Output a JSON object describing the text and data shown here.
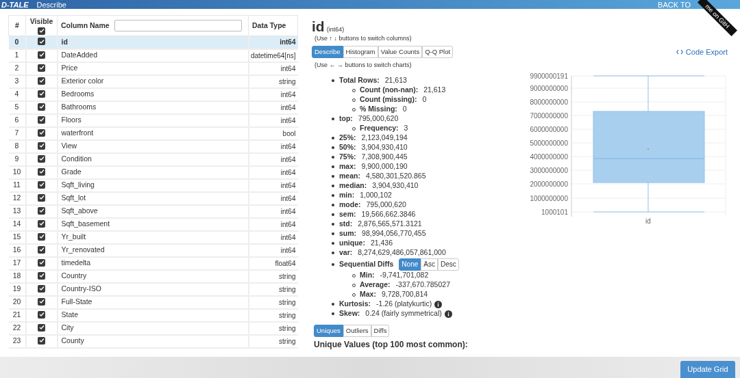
{
  "header": {
    "logo": "D-TALE",
    "title": "Describe",
    "back_label": "BACK TO",
    "ribbon": "me on GitH"
  },
  "columns_table": {
    "headers": {
      "index": "#",
      "visible": "Visible",
      "name": "Column Name",
      "dtype": "Data Type"
    },
    "all_visible": true,
    "rows": [
      {
        "index": "0",
        "name": "id",
        "dtype": "int64",
        "visible": true,
        "selected": true
      },
      {
        "index": "1",
        "name": "DateAdded",
        "dtype": "datetime64[ns]",
        "visible": true,
        "selected": false
      },
      {
        "index": "2",
        "name": "Price",
        "dtype": "int64",
        "visible": true,
        "selected": false
      },
      {
        "index": "3",
        "name": "Exterior color",
        "dtype": "string",
        "visible": true,
        "selected": false
      },
      {
        "index": "4",
        "name": "Bedrooms",
        "dtype": "int64",
        "visible": true,
        "selected": false
      },
      {
        "index": "5",
        "name": "Bathrooms",
        "dtype": "int64",
        "visible": true,
        "selected": false
      },
      {
        "index": "6",
        "name": "Floors",
        "dtype": "int64",
        "visible": true,
        "selected": false
      },
      {
        "index": "7",
        "name": "waterfront",
        "dtype": "bool",
        "visible": true,
        "selected": false
      },
      {
        "index": "8",
        "name": "View",
        "dtype": "int64",
        "visible": true,
        "selected": false
      },
      {
        "index": "9",
        "name": "Condition",
        "dtype": "int64",
        "visible": true,
        "selected": false
      },
      {
        "index": "10",
        "name": "Grade",
        "dtype": "int64",
        "visible": true,
        "selected": false
      },
      {
        "index": "11",
        "name": "Sqft_living",
        "dtype": "int64",
        "visible": true,
        "selected": false
      },
      {
        "index": "12",
        "name": "Sqft_lot",
        "dtype": "int64",
        "visible": true,
        "selected": false
      },
      {
        "index": "13",
        "name": "Sqft_above",
        "dtype": "int64",
        "visible": true,
        "selected": false
      },
      {
        "index": "14",
        "name": "Sqft_basement",
        "dtype": "int64",
        "visible": true,
        "selected": false
      },
      {
        "index": "15",
        "name": "Yr_built",
        "dtype": "int64",
        "visible": true,
        "selected": false
      },
      {
        "index": "16",
        "name": "Yr_renovated",
        "dtype": "int64",
        "visible": true,
        "selected": false
      },
      {
        "index": "17",
        "name": "timedelta",
        "dtype": "float64",
        "visible": true,
        "selected": false
      },
      {
        "index": "18",
        "name": "Country",
        "dtype": "string",
        "visible": true,
        "selected": false
      },
      {
        "index": "19",
        "name": "Country-ISO",
        "dtype": "string",
        "visible": true,
        "selected": false
      },
      {
        "index": "20",
        "name": "Full-State",
        "dtype": "string",
        "visible": true,
        "selected": false
      },
      {
        "index": "21",
        "name": "State",
        "dtype": "string",
        "visible": true,
        "selected": false
      },
      {
        "index": "22",
        "name": "City",
        "dtype": "string",
        "visible": true,
        "selected": false
      },
      {
        "index": "23",
        "name": "County",
        "dtype": "string",
        "visible": true,
        "selected": false
      }
    ]
  },
  "details": {
    "column": "id",
    "dtype": "(int64)",
    "hint_columns": "(Use ↑ ↓ buttons to switch columns)",
    "chart_tabs": [
      {
        "label": "Describe",
        "selected": true
      },
      {
        "label": "Histogram",
        "selected": false
      },
      {
        "label": "Value Counts",
        "selected": false
      },
      {
        "label": "Q-Q Plot",
        "selected": false
      }
    ],
    "hint_charts": "(Use ← → buttons to switch charts)",
    "code_export": "Code Export",
    "stats": [
      {
        "kind": "stat",
        "label": "Total Rows:",
        "value": "21,613",
        "children": [
          {
            "label": "Count (non-nan):",
            "value": "21,613"
          },
          {
            "label": "Count (missing):",
            "value": "0"
          },
          {
            "label": "% Missing:",
            "value": "0"
          }
        ]
      },
      {
        "kind": "stat",
        "label": "top:",
        "value": "795,000,620",
        "children": [
          {
            "label": "Frequency:",
            "value": "3"
          }
        ]
      },
      {
        "kind": "stat",
        "label": "25%:",
        "value": "2,123,049,194"
      },
      {
        "kind": "stat",
        "label": "50%:",
        "value": "3,904,930,410"
      },
      {
        "kind": "stat",
        "label": "75%:",
        "value": "7,308,900,445"
      },
      {
        "kind": "stat",
        "label": "max:",
        "value": "9,900,000,190"
      },
      {
        "kind": "stat",
        "label": "mean:",
        "value": "4,580,301,520.865"
      },
      {
        "kind": "stat",
        "label": "median:",
        "value": "3,904,930,410"
      },
      {
        "kind": "stat",
        "label": "min:",
        "value": "1,000,102"
      },
      {
        "kind": "stat",
        "label": "mode:",
        "value": "795,000,620"
      },
      {
        "kind": "stat",
        "label": "sem:",
        "value": "19,566,662.3846"
      },
      {
        "kind": "stat",
        "label": "std:",
        "value": "2,876,565,571.3121"
      },
      {
        "kind": "stat",
        "label": "sum:",
        "value": "98,994,056,770,455"
      },
      {
        "kind": "stat",
        "label": "unique:",
        "value": "21,436"
      },
      {
        "kind": "stat",
        "label": "var:",
        "value": "8,274,629,486,057,861,000"
      },
      {
        "kind": "toggle",
        "label": "Sequential Diffs",
        "options": [
          {
            "label": "None",
            "selected": true
          },
          {
            "label": "Asc",
            "selected": false
          },
          {
            "label": "Desc",
            "selected": false
          }
        ],
        "children": [
          {
            "label": "Min:",
            "value": "-9,741,701,082"
          },
          {
            "label": "Average:",
            "value": "-337,670.785027"
          },
          {
            "label": "Max:",
            "value": "9,728,700,814"
          }
        ]
      },
      {
        "kind": "info",
        "label": "Kurtosis:",
        "value": "-1.26 (platykurtic)"
      },
      {
        "kind": "info",
        "label": "Skew:",
        "value": "0.24 (fairly symmetrical)"
      }
    ],
    "bottom_tabs": [
      {
        "label": "Uniques",
        "selected": true
      },
      {
        "label": "Outliers",
        "selected": false
      },
      {
        "label": "Diffs",
        "selected": false
      }
    ],
    "uniques_heading": "Unique Values (top 100 most common):"
  },
  "chart": {
    "axis_labels": [
      "9900000191",
      "9000000000",
      "8000000000",
      "7000000000",
      "6000000000",
      "5000000000",
      "4000000000",
      "3000000000",
      "2000000000",
      "1000000000",
      "1000101"
    ],
    "category": "id"
  },
  "footer": {
    "update_button": "Update Grid"
  }
}
